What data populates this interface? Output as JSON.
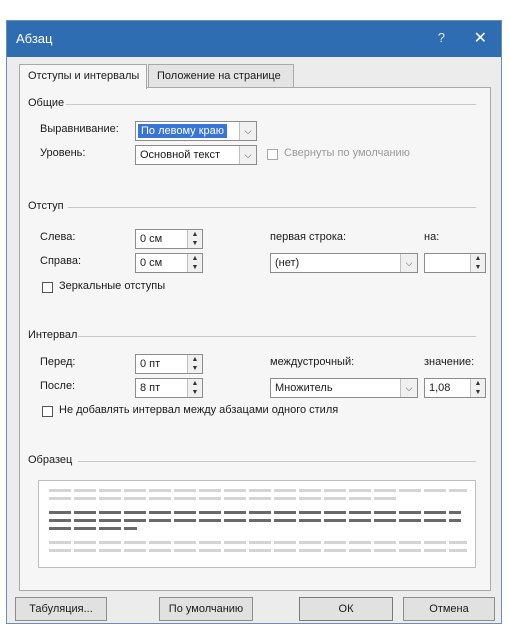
{
  "window": {
    "title": "Абзац",
    "help_label": "?",
    "close_label": "✕"
  },
  "tabs": [
    {
      "label": "Отступы и интервалы",
      "active": true
    },
    {
      "label": "Положение на странице",
      "active": false
    }
  ],
  "general": {
    "group_label": "Общие",
    "alignment_label": "Выравнивание:",
    "alignment_value": "По левому краю",
    "level_label": "Уровень:",
    "level_value": "Основной текст",
    "collapsed_label": "Свернуты по умолчанию"
  },
  "indent": {
    "group_label": "Отступ",
    "left_label": "Слева:",
    "left_value": "0 см",
    "right_label": "Справа:",
    "right_value": "0 см",
    "first_line_label": "первая строка:",
    "first_line_value": "(нет)",
    "by_label": "на:",
    "by_value": "",
    "mirror_label": "Зеркальные отступы"
  },
  "spacing": {
    "group_label": "Интервал",
    "before_label": "Перед:",
    "before_value": "0 пт",
    "after_label": "После:",
    "after_value": "8 пт",
    "line_spacing_label": "междустрочный:",
    "line_spacing_value": "Множитель",
    "at_label": "значение:",
    "at_value": "1,08",
    "dont_add_label": "Не добавлять интервал между абзацами одного стиля"
  },
  "preview": {
    "group_label": "Образец"
  },
  "buttons": {
    "tabs_label": "Табуляция...",
    "default_label": "По умолчанию",
    "ok_label": "ОК",
    "cancel_label": "Отмена"
  },
  "colors": {
    "titlebar": "#2f6db3",
    "selection": "#3875d7",
    "dialog_bg": "#ececec"
  }
}
